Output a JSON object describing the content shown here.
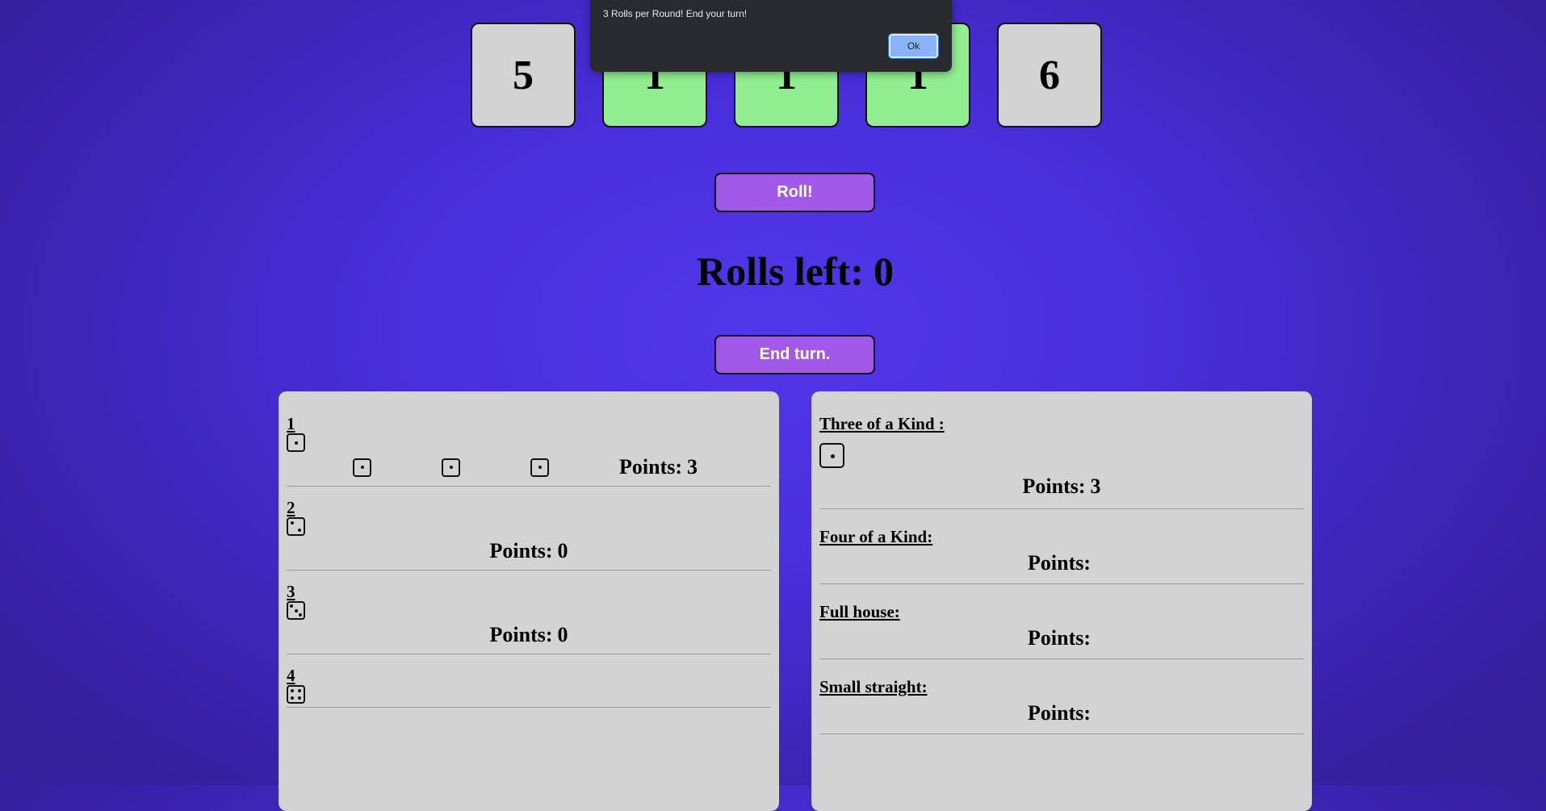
{
  "dice": [
    {
      "value": "5",
      "held": false
    },
    {
      "value": "1",
      "held": true
    },
    {
      "value": "1",
      "held": true
    },
    {
      "value": "1",
      "held": true
    },
    {
      "value": "6",
      "held": false
    }
  ],
  "roll_button": "Roll!",
  "rolls_left": {
    "label": "Rolls left:",
    "value": "0"
  },
  "end_turn_button": "End turn.",
  "upper_section": [
    {
      "title": "1",
      "face": 1,
      "matched_faces": [
        1,
        1,
        1
      ],
      "points_label": "Points:",
      "points": "3"
    },
    {
      "title": "2",
      "face": 2,
      "matched_faces": [],
      "points_label": "Points:",
      "points": "0"
    },
    {
      "title": "3",
      "face": 3,
      "matched_faces": [],
      "points_label": "Points:",
      "points": "0"
    },
    {
      "title": "4",
      "face": 4,
      "matched_faces": [],
      "points_label": "Points:",
      "points": ""
    }
  ],
  "lower_section": [
    {
      "title": "Three of a Kind :",
      "face": 1,
      "points_label": "Points:",
      "points": "3"
    },
    {
      "title": "Four of a Kind:",
      "face": null,
      "points_label": "Points:",
      "points": ""
    },
    {
      "title": "Full house:",
      "face": null,
      "points_label": "Points:",
      "points": ""
    },
    {
      "title": "Small straight:",
      "face": null,
      "points_label": "Points:",
      "points": ""
    }
  ],
  "alert": {
    "message": "3 Rolls per Round! End your turn!",
    "ok_label": "Ok"
  },
  "colors": {
    "held_die": "#90ee90",
    "die": "#d3d3d3",
    "button": "#a259e9",
    "panel": "#d3d3d3"
  },
  "icons": {
    "die_face": "die-face-icon"
  }
}
